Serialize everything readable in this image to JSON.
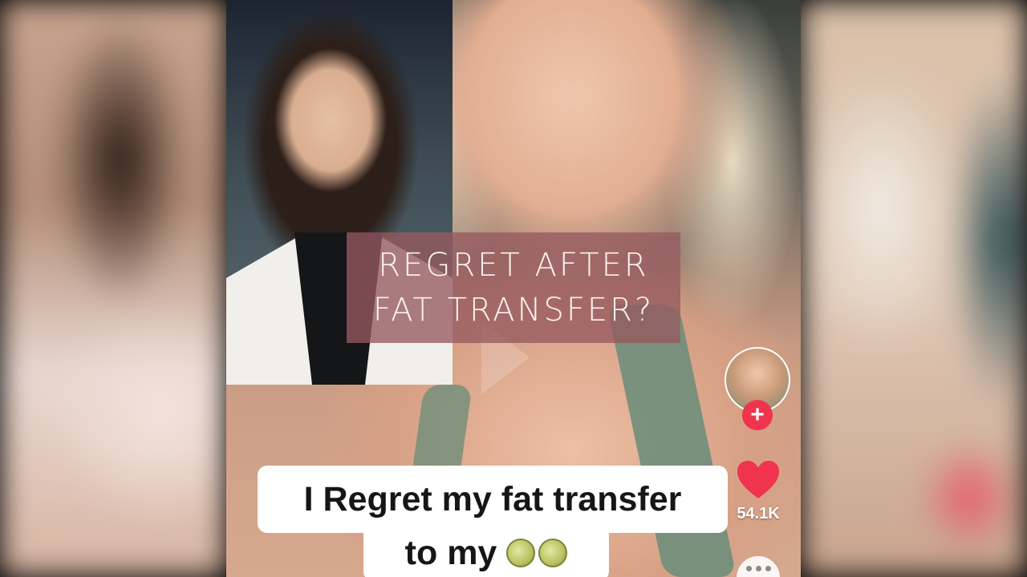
{
  "overlay": {
    "title_line1": "REGRET AFTER",
    "title_line2": "FAT TRANSFER?"
  },
  "caption": {
    "line1": "I Regret my fat transfer",
    "line2_text": "to my",
    "line2_emoji": "melon-emoji"
  },
  "rail": {
    "like_count": "54.1K",
    "follow_symbol": "+",
    "icons": [
      "avatar",
      "plus-icon",
      "heart-icon",
      "more-icon"
    ]
  },
  "colors": {
    "title_box": "#965a5f",
    "follow_red": "#f0344e",
    "heart_red": "#f0344e",
    "caption_bg": "#ffffff"
  }
}
